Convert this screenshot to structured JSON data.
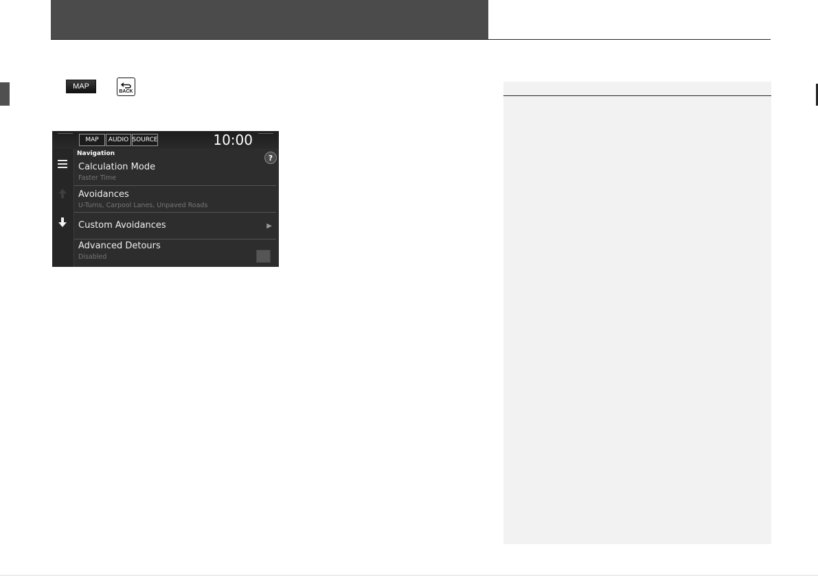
{
  "instruction_icons": {
    "map_button_label": "MAP",
    "back_button_label": "BACK"
  },
  "nav_screen": {
    "top_buttons": [
      "MAP",
      "AUDIO",
      "SOURCE"
    ],
    "clock": "10:00",
    "section_title": "Navigation",
    "help_label": "?",
    "rows": [
      {
        "title": "Calculation Mode",
        "subtitle": "Faster Time"
      },
      {
        "title": "Avoidances",
        "subtitle": "U-Turns, Carpool Lanes, Unpaved Roads"
      },
      {
        "title": "Custom Avoidances",
        "subtitle": ""
      },
      {
        "title": "Advanced Detours",
        "subtitle": "Disabled"
      }
    ],
    "icons": {
      "menu": "menu-icon",
      "up": "up-arrow-icon",
      "down": "down-arrow-icon",
      "chevron": "chevron-right-icon",
      "checkbox": "checkbox-icon"
    },
    "colors": {
      "screen_bg": "#2d2d2d",
      "header_bar": "#4b4b4b",
      "side_panel": "#f2f2f2"
    }
  }
}
